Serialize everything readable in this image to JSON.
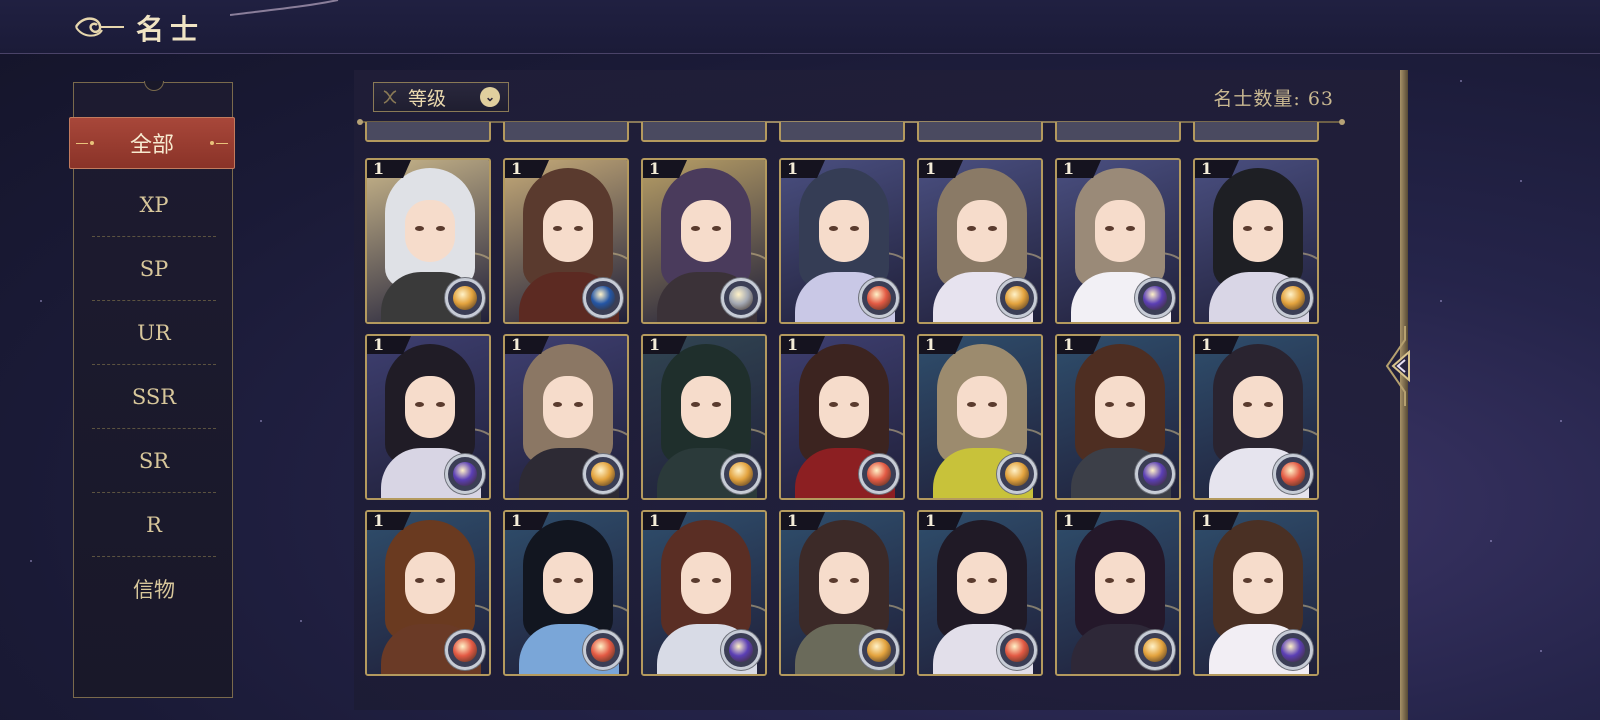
{
  "header": {
    "title": "名士"
  },
  "sidebar": {
    "items": [
      {
        "label": "全部",
        "active": true
      },
      {
        "label": "XP"
      },
      {
        "label": "SP"
      },
      {
        "label": "UR"
      },
      {
        "label": "SSR"
      },
      {
        "label": "SR"
      },
      {
        "label": "R"
      },
      {
        "label": "信物"
      }
    ]
  },
  "toolbar": {
    "sort_label": "等级",
    "count_label": "名士数量: 63"
  },
  "cards": [
    {
      "level": "1",
      "badge": "gold",
      "bg": "#c9b68a",
      "hair": "#dfe1e6",
      "outfit": "#3a3a3a"
    },
    {
      "level": "1",
      "badge": "blue",
      "bg": "#c5aa78",
      "hair": "#5a3a2e",
      "outfit": "#5c2a22"
    },
    {
      "level": "1",
      "badge": "silver",
      "bg": "#b79e66",
      "hair": "#4a3b5c",
      "outfit": "#3b3238"
    },
    {
      "level": "1",
      "badge": "red",
      "bg": "#4a4f80",
      "hair": "#353d55",
      "outfit": "#c9c8e6"
    },
    {
      "level": "1",
      "badge": "gold",
      "bg": "#4a4f80",
      "hair": "#8a7a66",
      "outfit": "#e7e3ef"
    },
    {
      "level": "1",
      "badge": "purple",
      "bg": "#4a4f80",
      "hair": "#9a8a78",
      "outfit": "#f2f0f5"
    },
    {
      "level": "1",
      "badge": "gold",
      "bg": "#4a4f80",
      "hair": "#1e1f24",
      "outfit": "#d9d6e6"
    },
    {
      "level": "1",
      "badge": "purple",
      "bg": "#3e3f70",
      "hair": "#201c26",
      "outfit": "#d8d5e4"
    },
    {
      "level": "1",
      "badge": "gold",
      "bg": "#3e3f70",
      "hair": "#8b7764",
      "outfit": "#2d2a34"
    },
    {
      "level": "1",
      "badge": "gold",
      "bg": "#314552",
      "hair": "#1f2f2c",
      "outfit": "#2b3a3a"
    },
    {
      "level": "1",
      "badge": "red",
      "bg": "#3e3f70",
      "hair": "#3c2420",
      "outfit": "#8c1f22"
    },
    {
      "level": "1",
      "badge": "gold",
      "bg": "#2f4e6c",
      "hair": "#9c8b6e",
      "outfit": "#c8c23a"
    },
    {
      "level": "1",
      "badge": "purple",
      "bg": "#2f4e6c",
      "hair": "#4e2e22",
      "outfit": "#3c3f48"
    },
    {
      "level": "1",
      "badge": "red",
      "bg": "#2f4e6c",
      "hair": "#2a2430",
      "outfit": "#e6e4ee"
    },
    {
      "level": "1",
      "badge": "red",
      "bg": "#2f4e6c",
      "hair": "#6a3a20",
      "outfit": "#6a3a26"
    },
    {
      "level": "1",
      "badge": "red",
      "bg": "#2f4e6c",
      "hair": "#121620",
      "outfit": "#7aa6d8"
    },
    {
      "level": "1",
      "badge": "purple",
      "bg": "#2f4e6c",
      "hair": "#5a2e24",
      "outfit": "#d8dbe6"
    },
    {
      "level": "1",
      "badge": "gold",
      "bg": "#2f4e6c",
      "hair": "#3c2a28",
      "outfit": "#6a6a5a"
    },
    {
      "level": "1",
      "badge": "red",
      "bg": "#2f4e6c",
      "hair": "#201a26",
      "outfit": "#e2dfea"
    },
    {
      "level": "1",
      "badge": "gold",
      "bg": "#2f4e6c",
      "hair": "#24182a",
      "outfit": "#2e2838"
    },
    {
      "level": "1",
      "badge": "purple",
      "bg": "#2f4e6c",
      "hair": "#4a3024",
      "outfit": "#f2eef4"
    }
  ],
  "colors": {
    "badge_gold": "#e3a33e",
    "badge_red": "#e35a44",
    "badge_purple": "#5b3fb5",
    "badge_blue": "#2456a6",
    "badge_silver": "#a4a9b4",
    "active_tab": "#a8473a",
    "frame_gold": "#b49a5e"
  }
}
